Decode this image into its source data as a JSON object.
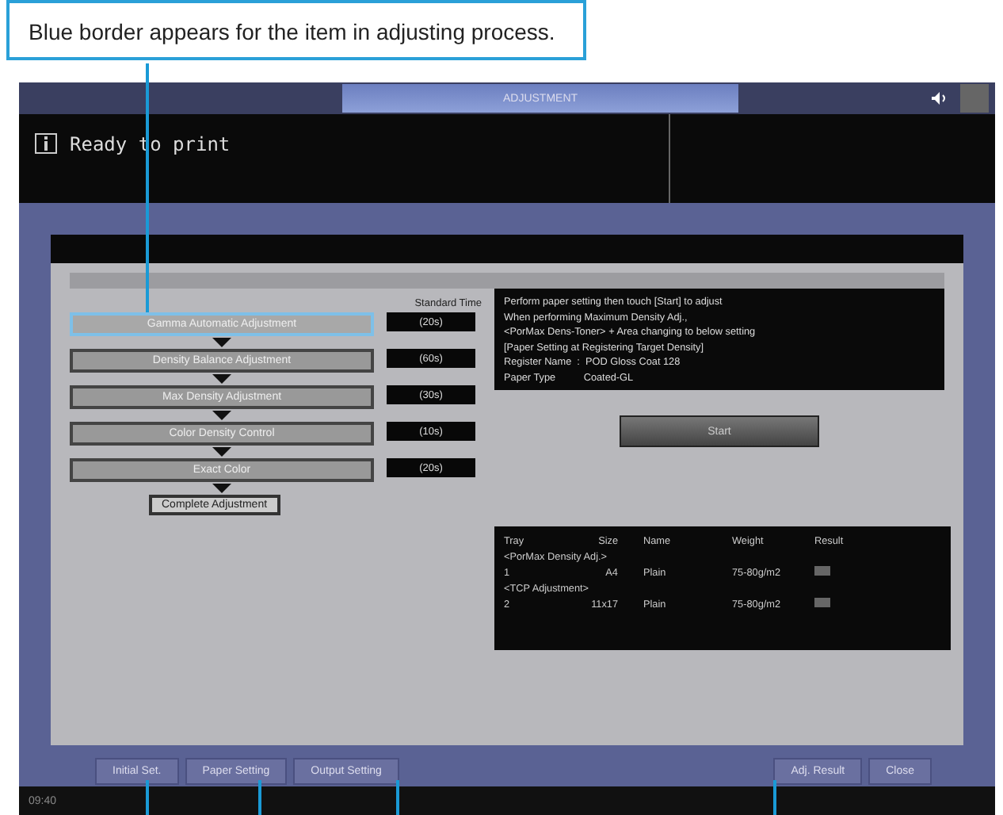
{
  "callout": "Blue border appears for the item in adjusting process.",
  "tab": "ADJUSTMENT",
  "status": "Ready to print",
  "steps_header": "Standard Time",
  "steps": [
    {
      "label": "Gamma Automatic Adjustment",
      "time": "(20s)",
      "selected": true
    },
    {
      "label": "Density Balance Adjustment",
      "time": "(60s)",
      "selected": false
    },
    {
      "label": "Max Density Adjustment",
      "time": "(30s)",
      "selected": false
    },
    {
      "label": "Color Density Control",
      "time": "(10s)",
      "selected": false
    },
    {
      "label": "Exact Color",
      "time": "(20s)",
      "selected": false
    }
  ],
  "complete": "Complete Adjustment",
  "message": [
    "Perform paper setting then touch [Start] to adjust",
    "When performing Maximum Density Adj.,",
    "<PorMax Dens-Toner> + Area changing to below setting",
    "[Paper Setting at Registering Target Density]",
    "Register Name  :  POD Gloss Coat 128",
    "Paper Type          Coated-GL"
  ],
  "start": "Start",
  "table": {
    "columns": [
      "Tray",
      "Size",
      "Name",
      "Weight",
      "Result"
    ],
    "rows": [
      {
        "kind": "group",
        "label": "<PorMax Density Adj.>"
      },
      {
        "kind": "item",
        "cells": [
          "1",
          "A4",
          "Plain",
          "75-80g/m2"
        ]
      },
      {
        "kind": "group",
        "label": "<TCP Adjustment>"
      },
      {
        "kind": "item",
        "cells": [
          "2",
          "11x17",
          "Plain",
          "75-80g/m2"
        ]
      }
    ]
  },
  "left_buttons": [
    "Initial Set.",
    "Paper Setting",
    "Output Setting"
  ],
  "right_buttons": [
    "Adj. Result",
    "Close"
  ],
  "clock": "09:40"
}
